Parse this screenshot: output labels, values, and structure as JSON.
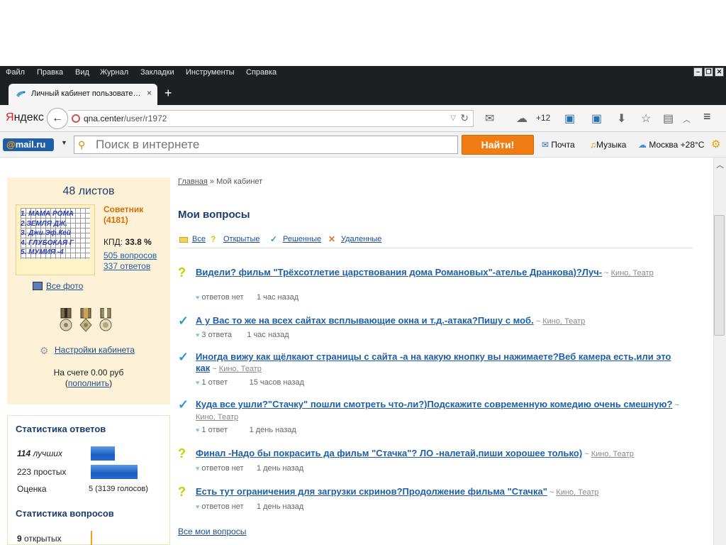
{
  "menu": [
    "Файл",
    "Правка",
    "Вид",
    "Журнал",
    "Закладки",
    "Инструменты",
    "Справка"
  ],
  "tab": {
    "title": "Личный кабинет пользовате…",
    "close": "×",
    "new": "+"
  },
  "nav": {
    "logo_first": "Я",
    "logo_rest": "ндекс",
    "back": "←",
    "url_host": "qna.center",
    "url_path": "/user/r1972",
    "weather_count": "+12"
  },
  "mailbar": {
    "logo_at": "@",
    "logo_name": "mail",
    "logo_tld": ".ru",
    "search_placeholder": "Поиск в интернете",
    "find_button": "Найти!",
    "mail": "Почта",
    "music": "Музыка",
    "weather": "Москва +28°C"
  },
  "profile": {
    "sheets": "48 листов",
    "avatar_lines": [
      "1. МАМА РОМА",
      "2.ЗЕМЛЯ ДЖ.",
      "3. Джи.Эф.Кей",
      "4. ГЛУБОКАЯ Г",
      "5. МУМИЯ -4"
    ],
    "rank": "Советник",
    "rank_points": "(4181)",
    "kpd_label": "КПД:",
    "kpd_value": "33.8 %",
    "questions_link": "505 вопросов",
    "answers_link": "337 ответов",
    "all_photo": "Все фото",
    "settings": "Настройки кабинета",
    "balance": "На счете 0.00 руб",
    "topup_open": "(",
    "topup": "пополнить",
    "topup_close": ")"
  },
  "answer_stats": {
    "title": "Статистика ответов",
    "best_count": "114",
    "best_label": "лучших",
    "simple_count": "223",
    "simple_label": "простых",
    "rating_label": "Оценка",
    "rating_value": "5 (3139 голосов)",
    "best_value": 114,
    "simple_value": 223
  },
  "question_stats": {
    "title": "Статистика вопросов",
    "open_count": "9",
    "open_label": "открытых"
  },
  "breadcrumb": {
    "home": "Главная",
    "sep": " » ",
    "current": "Мой кабинет"
  },
  "main_title": "Мои вопросы",
  "filters": [
    "Все",
    "Открытые",
    "Решенные",
    "Удаленные"
  ],
  "questions": [
    {
      "status": "open",
      "title": "Видели? фильм \"Трёхсотлетие царствования дома Романовых\"-ателье Дранкова)?Луч-",
      "cat_sep": " ~ ",
      "category": "Кино, Театр",
      "answers": "ответов нет",
      "time": "1 час назад"
    },
    {
      "status": "solved",
      "title": "А у Вас то же на всех сайтах всплывающие окна и т.д.-атака?Пишу с моб.",
      "cat_sep": " ~ ",
      "category": "Кино, Театр",
      "answers": "3 ответа",
      "time": "1 час назад"
    },
    {
      "status": "solved",
      "title": "Иногда вижу как щёлкают страницы с сайта -а на какую кнопку вы нажимаете?Веб камера есть,или это как",
      "cat_sep": " ~ ",
      "category": "Кино, Театр",
      "answers": "1 ответ",
      "time": "15 часов назад"
    },
    {
      "status": "solved",
      "title": "Куда все ушли?\"Стачку\" пошли смотреть что-ли?)Подскажите современную комедию очень смешную?",
      "cat_sep": " ~ ",
      "category": "Кино, Театр",
      "answers": "1 ответ",
      "time": "1 день назад"
    },
    {
      "status": "open",
      "title": "Финал -Надо бы покрасить да фильм \"Стачка\"? ЛО -налетай,пиши хорошее только)",
      "cat_sep": " ~ ",
      "category": "Кино, Театр",
      "answers": "ответов нет",
      "time": "1 день назад"
    },
    {
      "status": "open",
      "title": "Есть тут ограничения для загрузки скринов?Продолжение фильма \"Стачка\"",
      "cat_sep": " ~ ",
      "category": "Кино, Театр",
      "answers": "ответов нет",
      "time": "1 день назад"
    }
  ],
  "all_my_questions": "Все мои вопросы",
  "colors": {
    "accent": "#1f5fa8",
    "find": "#f07d13",
    "card": "#fdf1d8",
    "open_mark": "#c3cf00",
    "solved_mark": "#2b9ad3"
  }
}
